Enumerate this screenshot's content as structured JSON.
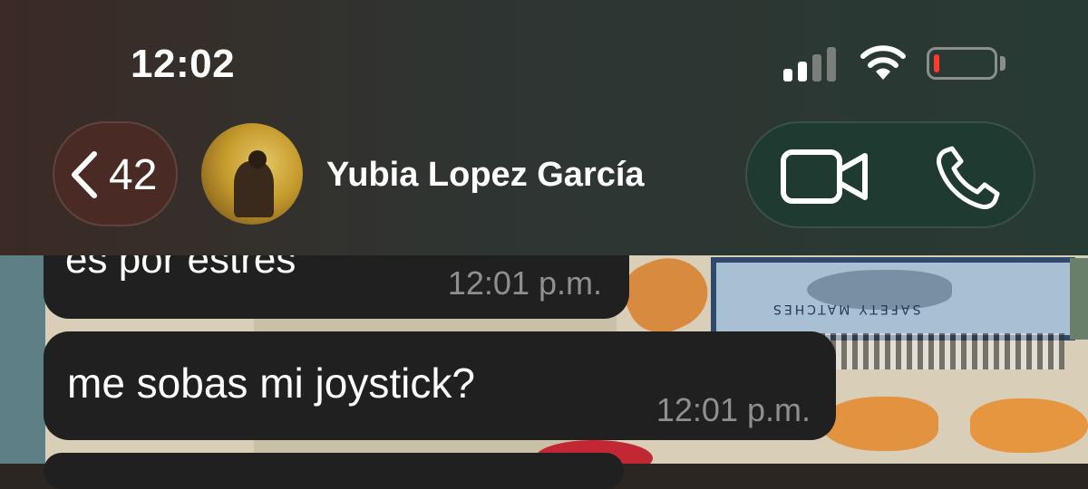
{
  "status_bar": {
    "time": "12:02",
    "signal_bars": 2,
    "battery_level": 0.1,
    "battery_color": "#ff3b30"
  },
  "header": {
    "back_count": "42",
    "contact_name": "Yubia Lopez García",
    "icons": [
      "chevron-left-icon",
      "video-camera-icon",
      "phone-icon"
    ]
  },
  "wallpaper": {
    "label": "SAFETY MATCHES"
  },
  "messages": [
    {
      "text": "es por estres",
      "time": "12:01 p.m."
    },
    {
      "text": "me sobas mi joystick?",
      "time": "12:01 p.m."
    }
  ]
}
